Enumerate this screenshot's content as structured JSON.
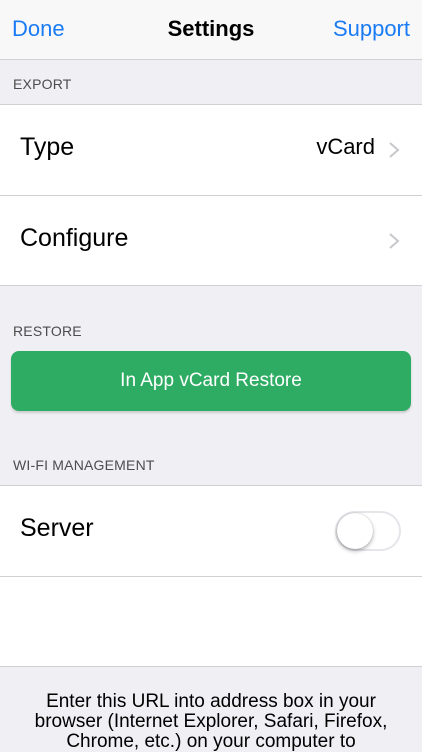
{
  "navbar": {
    "left_label": "Done",
    "title": "Settings",
    "right_label": "Support"
  },
  "export": {
    "header": "EXPORT",
    "rows": [
      {
        "label": "Type",
        "value": "vCard"
      },
      {
        "label": "Configure",
        "value": ""
      }
    ]
  },
  "restore": {
    "header": "RESTORE",
    "button_label": "In App vCard Restore",
    "button_color": "#2fac63"
  },
  "wifi": {
    "header": "WI-FI MANAGEMENT",
    "server_label": "Server",
    "server_enabled": false,
    "info_text": "Enter this URL into address box in your browser (Internet Explorer, Safari, Firefox, Chrome, etc.) on your computer to"
  },
  "colors": {
    "accent": "#1a7cf5",
    "background": "#efeff4"
  }
}
